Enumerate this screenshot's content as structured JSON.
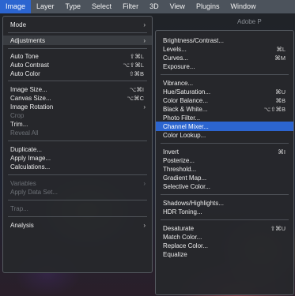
{
  "menubar": {
    "items": [
      "Image",
      "Layer",
      "Type",
      "Select",
      "Filter",
      "3D",
      "View",
      "Plugins",
      "Window"
    ]
  },
  "image_menu": {
    "items": [
      {
        "label": "Mode",
        "arrow": "›"
      },
      {
        "label": "Adjustments",
        "arrow": "›"
      },
      {
        "label": "Auto Tone",
        "shortcut": "⇧⌘L"
      },
      {
        "label": "Auto Contrast",
        "shortcut": "⌥⇧⌘L"
      },
      {
        "label": "Auto Color",
        "shortcut": "⇧⌘B"
      },
      {
        "label": "Image Size...",
        "shortcut": "⌥⌘I"
      },
      {
        "label": "Canvas Size...",
        "shortcut": "⌥⌘C"
      },
      {
        "label": "Image Rotation",
        "arrow": "›"
      },
      {
        "label": "Crop"
      },
      {
        "label": "Trim..."
      },
      {
        "label": "Reveal All"
      },
      {
        "label": "Duplicate..."
      },
      {
        "label": "Apply Image..."
      },
      {
        "label": "Calculations..."
      },
      {
        "label": "Variables",
        "arrow": "›"
      },
      {
        "label": "Apply Data Set..."
      },
      {
        "label": "Trap..."
      },
      {
        "label": "Analysis",
        "arrow": "›"
      }
    ]
  },
  "adjustments_menu": {
    "corner_text": "Adobe P",
    "items": [
      {
        "label": "Brightness/Contrast..."
      },
      {
        "label": "Levels...",
        "shortcut": "⌘L"
      },
      {
        "label": "Curves...",
        "shortcut": "⌘M"
      },
      {
        "label": "Exposure..."
      },
      {
        "label": "Vibrance..."
      },
      {
        "label": "Hue/Saturation...",
        "shortcut": "⌘U"
      },
      {
        "label": "Color Balance...",
        "shortcut": "⌘B"
      },
      {
        "label": "Black & White...",
        "shortcut": "⌥⇧⌘B"
      },
      {
        "label": "Photo Filter..."
      },
      {
        "label": "Channel Mixer..."
      },
      {
        "label": "Color Lookup..."
      },
      {
        "label": "Invert",
        "shortcut": "⌘I"
      },
      {
        "label": "Posterize..."
      },
      {
        "label": "Threshold..."
      },
      {
        "label": "Gradient Map..."
      },
      {
        "label": "Selective Color..."
      },
      {
        "label": "Shadows/Highlights..."
      },
      {
        "label": "HDR Toning..."
      },
      {
        "label": "Desaturate",
        "shortcut": "⇧⌘U"
      },
      {
        "label": "Match Color..."
      },
      {
        "label": "Replace Color..."
      },
      {
        "label": "Equalize"
      }
    ]
  },
  "colors": {
    "menubar": "#4c535c",
    "selection": "#2c65d0",
    "menu_bg": "#26282c"
  }
}
